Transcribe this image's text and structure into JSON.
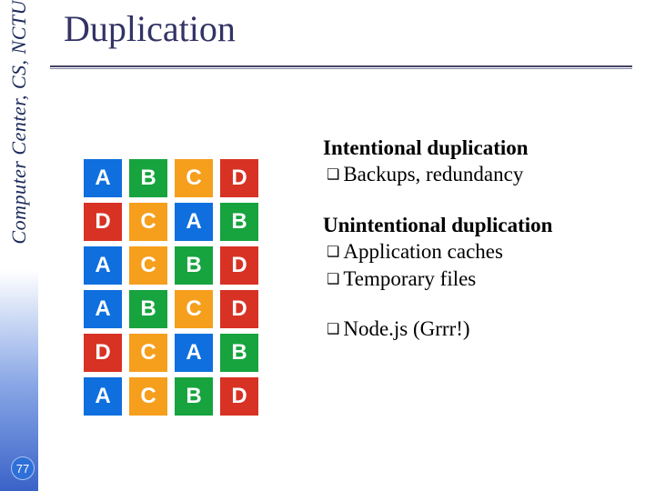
{
  "sidebar": {
    "label": "Computer Center, CS, NCTU"
  },
  "title": "Duplication",
  "page_number": "77",
  "grid": {
    "rows": [
      [
        {
          "t": "A",
          "c": "blue"
        },
        {
          "t": "B",
          "c": "green"
        },
        {
          "t": "C",
          "c": "orange"
        },
        {
          "t": "D",
          "c": "red"
        }
      ],
      [
        {
          "t": "D",
          "c": "red"
        },
        {
          "t": "C",
          "c": "orange"
        },
        {
          "t": "A",
          "c": "blue"
        },
        {
          "t": "B",
          "c": "green"
        }
      ],
      [
        {
          "t": "A",
          "c": "blue"
        },
        {
          "t": "C",
          "c": "orange"
        },
        {
          "t": "B",
          "c": "green"
        },
        {
          "t": "D",
          "c": "red"
        }
      ],
      [
        {
          "t": "A",
          "c": "blue"
        },
        {
          "t": "B",
          "c": "green"
        },
        {
          "t": "C",
          "c": "orange"
        },
        {
          "t": "D",
          "c": "red"
        }
      ],
      [
        {
          "t": "D",
          "c": "red"
        },
        {
          "t": "C",
          "c": "orange"
        },
        {
          "t": "A",
          "c": "blue"
        },
        {
          "t": "B",
          "c": "green"
        }
      ],
      [
        {
          "t": "A",
          "c": "blue"
        },
        {
          "t": "C",
          "c": "orange"
        },
        {
          "t": "B",
          "c": "green"
        },
        {
          "t": "D",
          "c": "red"
        }
      ]
    ]
  },
  "sections": {
    "intentional": {
      "heading": "Intentional duplication",
      "items": [
        "Backups, redundancy"
      ]
    },
    "unintentional": {
      "heading": "Unintentional duplication",
      "items": [
        "Application caches",
        "Temporary files"
      ]
    },
    "extra": {
      "items": [
        "Node.js (Grrr!)"
      ]
    }
  },
  "bullet_glyph": "❑"
}
